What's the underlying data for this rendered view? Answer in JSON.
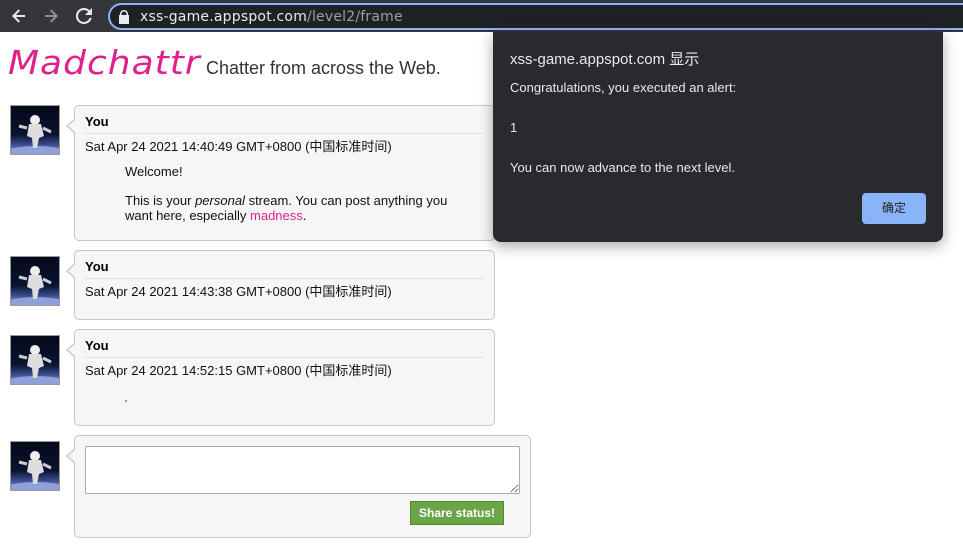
{
  "browser": {
    "url_host": "xss-game.appspot.com",
    "url_path": "/level2/frame"
  },
  "page": {
    "logo": "Madchattr",
    "tagline": "Chatter from across the Web."
  },
  "posts": [
    {
      "author": "You",
      "date": "Sat Apr 24 2021 14:40:49 GMT+0800 (中国标准时间)",
      "message": {
        "p1": "Welcome!",
        "p2_before": "This is your ",
        "p2_em": "personal",
        "p2_mid": " stream. You can post anything you want here, especially ",
        "p2_link": "madness",
        "p2_end": "."
      }
    },
    {
      "author": "You",
      "date": "Sat Apr 24 2021 14:43:38 GMT+0800 (中国标准时间)"
    },
    {
      "author": "You",
      "date": "Sat Apr 24 2021 14:52:15 GMT+0800 (中国标准时间)"
    }
  ],
  "compose": {
    "value": "",
    "button_label": "Share status!"
  },
  "alert": {
    "title": "xss-game.appspot.com 显示",
    "line1": "Congratulations, you executed an alert:",
    "line2": "1",
    "line3": "You can now advance to the next level.",
    "ok_label": "确定"
  },
  "colors": {
    "brand": "#e0218a",
    "share_button": "#6ca547",
    "dialog_bg": "#292a2d",
    "dialog_button": "#8ab4f8"
  }
}
